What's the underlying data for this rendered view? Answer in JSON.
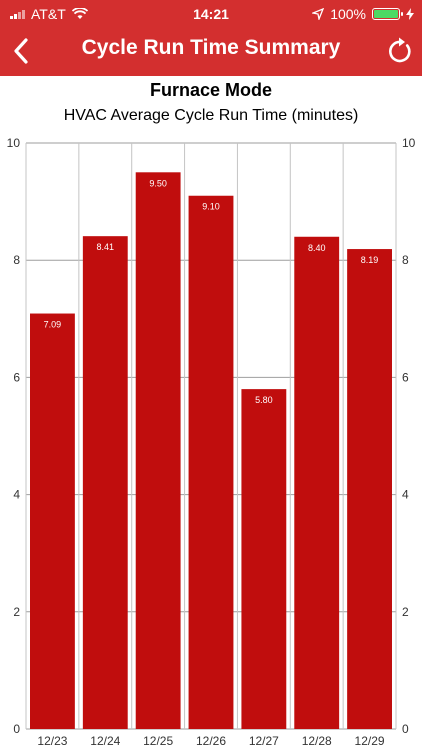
{
  "status_bar": {
    "carrier": "AT&T",
    "time": "14:21",
    "battery_percent": "100%"
  },
  "navbar": {
    "title": "Cycle Run Time Summary"
  },
  "mode_title": "Furnace Mode",
  "chart_data": {
    "type": "bar",
    "title": "HVAC Average Cycle Run Time (minutes)",
    "categories": [
      "12/23",
      "12/24",
      "12/25",
      "12/26",
      "12/27",
      "12/28",
      "12/29"
    ],
    "values": [
      7.09,
      8.41,
      9.5,
      9.1,
      5.8,
      8.4,
      8.19
    ],
    "value_labels": [
      "7.09",
      "8.41",
      "9.50",
      "9.10",
      "5.80",
      "8.40",
      "8.19"
    ],
    "ylim": [
      0,
      10
    ],
    "yticks": [
      "0",
      "2",
      "4",
      "6",
      "8",
      "10"
    ],
    "ytick_values": [
      0,
      2,
      4,
      6,
      8,
      10
    ],
    "dual_y_axis": true,
    "grid": true,
    "bar_color": "#c00d0d"
  },
  "colors": {
    "header": "#d32f2f",
    "bar": "#c00d0d",
    "battery_fill": "#4cd964"
  },
  "icons": {
    "back": "chevron-left-icon",
    "refresh": "refresh-icon",
    "wifi": "wifi-icon",
    "location": "location-arrow-icon",
    "battery": "battery-icon",
    "charging": "lightning-icon"
  }
}
